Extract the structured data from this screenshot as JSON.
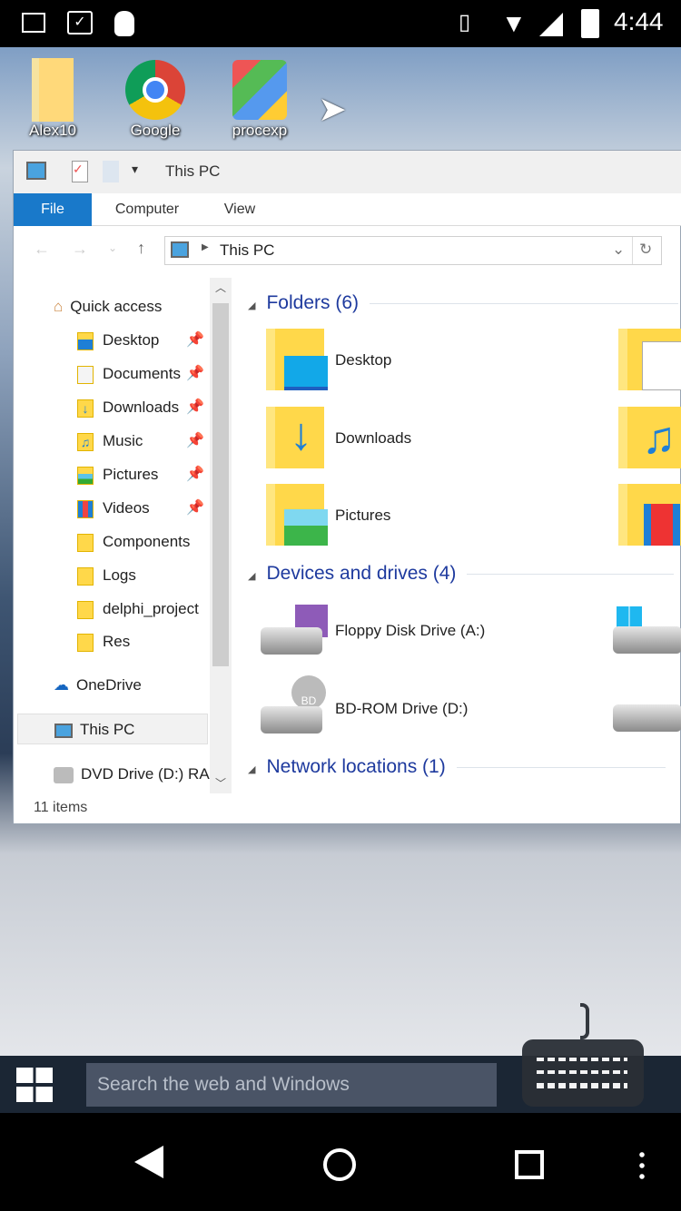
{
  "status": {
    "time": "4:44"
  },
  "desktop": {
    "icons": [
      {
        "label": "Alex10"
      },
      {
        "label": "Google"
      },
      {
        "label": "procexp"
      }
    ]
  },
  "window": {
    "title": "This PC",
    "ribbon": {
      "tabs": [
        "File",
        "Computer",
        "View"
      ]
    },
    "address": {
      "path": "This PC"
    },
    "nav": {
      "quick_access": "Quick access",
      "items": [
        "Desktop",
        "Documents",
        "Downloads",
        "Music",
        "Pictures",
        "Videos",
        "Components",
        "Logs",
        "delphi_project",
        "Res"
      ],
      "onedrive": "OneDrive",
      "this_pc": "This PC",
      "dvd": "DVD Drive (D:) RA"
    },
    "sections": {
      "folders": {
        "title": "Folders (6)",
        "items": [
          "Desktop",
          "Downloads",
          "Pictures"
        ]
      },
      "devices": {
        "title": "Devices and drives (4)",
        "items": [
          "Floppy Disk Drive (A:)",
          "BD-ROM Drive (D:)"
        ],
        "bd_label": "BD"
      },
      "network": {
        "title": "Network locations (1)"
      }
    },
    "status_bar": {
      "count": "11 items"
    }
  },
  "taskbar": {
    "search_placeholder": "Search the web and Windows"
  },
  "colors": {
    "accent": "#1979ca",
    "section_title": "#1e3a9e",
    "folder": "#ffd84a"
  }
}
